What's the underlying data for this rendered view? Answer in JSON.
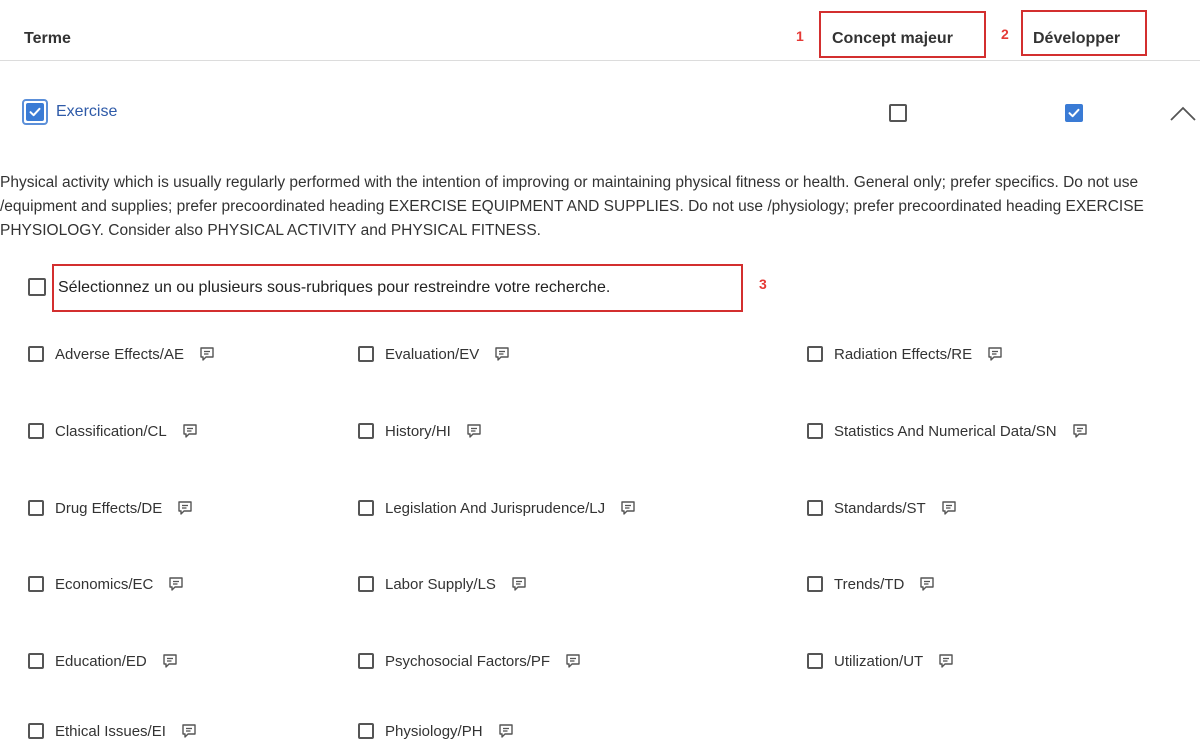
{
  "header": {
    "term_label": "Terme",
    "major_concept_label": "Concept majeur",
    "expand_label": "Développer",
    "annotation_1": "1",
    "annotation_2": "2",
    "annotation_3": "3"
  },
  "term": {
    "name": "Exercise",
    "checked": true,
    "major_concept_checked": false,
    "expand_checked": true,
    "description": "Physical activity which is usually regularly performed with the intention of improving or maintaining physical fitness or health. General only; prefer specifics. Do not use /equipment and supplies; prefer precoordinated heading EXERCISE EQUIPMENT AND SUPPLIES. Do not use /physiology; prefer precoordinated heading EXERCISE PHYSIOLOGY. Consider also PHYSICAL ACTIVITY and PHYSICAL FITNESS."
  },
  "subheadings": {
    "select_all_label": "Sélectionnez un ou plusieurs sous-rubriques pour restreindre votre recherche.",
    "columns": [
      [
        "Adverse Effects/AE",
        "Classification/CL",
        "Drug Effects/DE",
        "Economics/EC",
        "Education/ED",
        "Ethical Issues/EI"
      ],
      [
        "Evaluation/EV",
        "History/HI",
        "Legislation And Jurisprudence/LJ",
        "Labor Supply/LS",
        "Psychosocial Factors/PF",
        "Physiology/PH"
      ],
      [
        "Radiation Effects/RE",
        "Statistics And Numerical Data/SN",
        "Standards/ST",
        "Trends/TD",
        "Utilization/UT"
      ]
    ]
  },
  "colors": {
    "accent": "#3a7bd5",
    "link": "#2e5aa8",
    "annotation": "#d32f2f"
  }
}
